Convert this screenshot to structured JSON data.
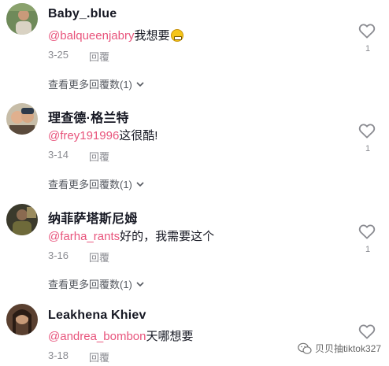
{
  "comments": [
    {
      "username": "Baby_.blue",
      "mention": "@balqueenjabry",
      "text": "我想要",
      "has_emoji": true,
      "emoji_name": "grinning-face-icon",
      "date": "3-25",
      "reply_label": "回覆",
      "likes": "1",
      "view_more": "查看更多回覆数(1)"
    },
    {
      "username": "理查德·格兰特",
      "mention": "@frey191996",
      "text": "这很酷!",
      "date": "3-14",
      "reply_label": "回覆",
      "likes": "1",
      "view_more": "查看更多回覆数(1)"
    },
    {
      "username": "纳菲萨塔斯尼姆",
      "mention": "@farha_rants",
      "text": "好的，我需要这个",
      "date": "3-16",
      "reply_label": "回覆",
      "likes": "1",
      "view_more": "查看更多回覆数(1)"
    },
    {
      "username": "Leakhena Khiev",
      "mention": "@andrea_bombon",
      "text": "天哪想要",
      "date": "3-18",
      "reply_label": "回覆",
      "likes": ""
    }
  ],
  "watermark": {
    "text": "贝贝抽tiktok327",
    "icon": "wechat-icon"
  },
  "colors": {
    "mention": "#e8547c",
    "username": "#161823",
    "meta": "#8a8b91"
  }
}
